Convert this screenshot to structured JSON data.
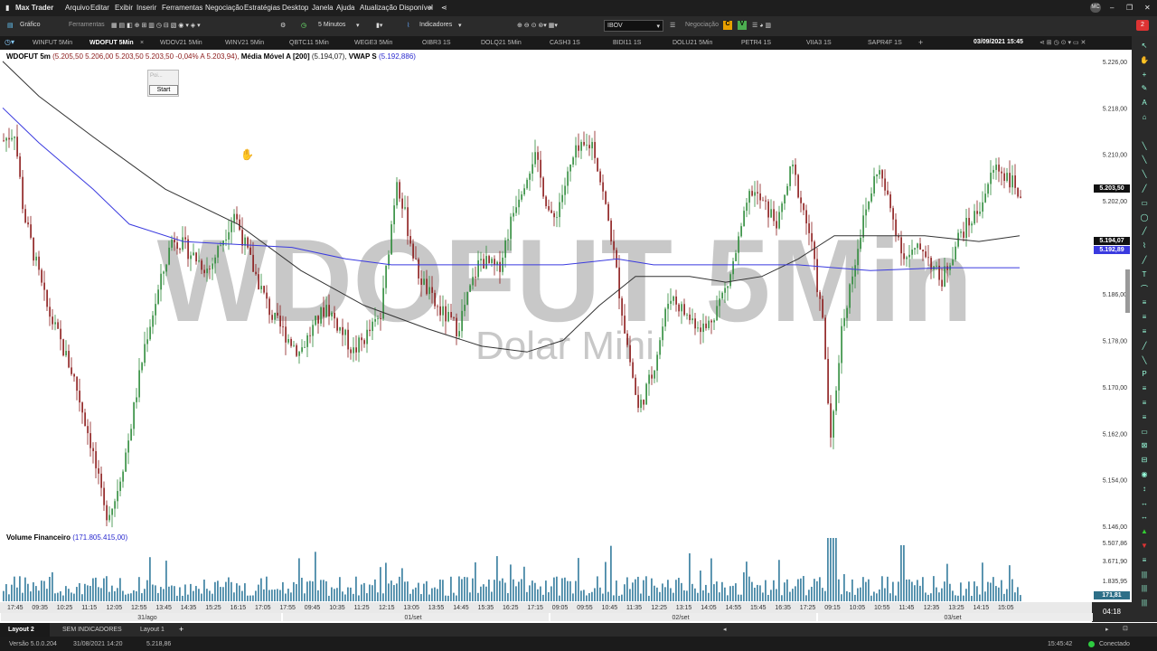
{
  "app": {
    "title": "Max Trader",
    "menu": [
      "Arquivo",
      "Editar",
      "Exibir",
      "Inserir",
      "Ferramentas",
      "Negociação",
      "Estratégias",
      "Desktop",
      "Janela",
      "Ajuda",
      "Atualização Disponível"
    ],
    "avatar": "MC",
    "notifications": "2"
  },
  "toolbar": {
    "grafico": "Gráfico",
    "ferramentas": "Ferramentas",
    "interval": "5 Minutos",
    "indicadores": "Indicadores",
    "symbol_input": "IBOV",
    "negociacao": "Negociação",
    "c_badge": "C",
    "v_badge": "V"
  },
  "tabs": [
    {
      "label": "WINFUT 5Min"
    },
    {
      "label": "WDOFUT 5Min",
      "active": true
    },
    {
      "label": "WDOV21 5Min"
    },
    {
      "label": "WINV21 5Min"
    },
    {
      "label": "QBTC11 5Min"
    },
    {
      "label": "WEGE3 5Min"
    },
    {
      "label": "OIBR3 1S"
    },
    {
      "label": "DOLQ21 5Min"
    },
    {
      "label": "CASH3 1S"
    },
    {
      "label": "BIDI11 1S"
    },
    {
      "label": "DOLU21 5Min"
    },
    {
      "label": "PETR4 1S"
    },
    {
      "label": "VIIA3 1S"
    },
    {
      "label": "SAPR4F 1S"
    }
  ],
  "tab_datetime": "03/09/2021 15:45",
  "chart": {
    "header_symbol": "WDOFUT 5m",
    "ohlc": "(5.205,50  5.206,00  5.203,50  5.203,50  -0,04%  A 5.203,94),",
    "ma_label": "Média Móvel A [200]",
    "ma_value": "(5.194,07),",
    "vwap_label": "VWAP S",
    "vwap_value": "(5.192,886)",
    "watermark": "WDOFUT 5Min",
    "watermark_sub": "Dolar Mini",
    "widget_placeholder": "Poi...",
    "start_button": "Start",
    "volume_label": "Volume Financeiro",
    "volume_value": "(171.805.415,00)",
    "price_ticks": [
      "5.226,00",
      "5.218,00",
      "5.210,00",
      "5.202,00",
      "5.186,00",
      "5.178,00",
      "5.170,00",
      "5.162,00",
      "5.154,00",
      "5.146,00"
    ],
    "volume_ticks": [
      "5.507,86",
      "3.671,90",
      "1.835,95"
    ],
    "last_price": "5.203,50",
    "ma_price": "5.194,07",
    "vwap_price": "5.192,89",
    "volume_tag": "171,81",
    "time_labels": [
      "17:45",
      "09:35",
      "10:25",
      "11:15",
      "12:05",
      "12:55",
      "13:45",
      "14:35",
      "15:25",
      "16:15",
      "17:05",
      "17:55",
      "09:45",
      "10:35",
      "11:25",
      "12:15",
      "13:05",
      "13:55",
      "14:45",
      "15:35",
      "16:25",
      "17:15",
      "09:05",
      "09:55",
      "10:45",
      "11:35",
      "12:25",
      "13:15",
      "14:05",
      "14:55",
      "15:45",
      "16:35",
      "17:25",
      "09:15",
      "10:05",
      "10:55",
      "11:45",
      "12:35",
      "13:25",
      "14:15",
      "15:05"
    ],
    "date_labels": [
      "31/ago",
      "01/set",
      "02/set",
      "03/set"
    ],
    "countdown": "04:18"
  },
  "chart_data": {
    "type": "candlestick",
    "symbol": "WDOFUT 5m",
    "y_range": [
      5144,
      5228
    ],
    "last": 5203.5,
    "ma200_last": 5194.07,
    "vwap_last": 5192.886,
    "key_levels": [
      5226,
      5218,
      5210,
      5202,
      5194,
      5186,
      5178,
      5170,
      5162,
      5154,
      5146
    ]
  },
  "bottom": {
    "layout_tab": "Layout 2",
    "sem_indicadores": "SEM INDICADORES",
    "layout1": "Layout 1",
    "plus": "+"
  },
  "status": {
    "version": "Versão 5.0.0.204",
    "date": "31/08/2021 14:20",
    "price": "5.218,86",
    "time": "15:45:42",
    "connection": "Conectado"
  },
  "colors": {
    "bull": "#2e8b3a",
    "bear": "#8b1a1a",
    "ma": "#333333",
    "vwap": "#3a3adf",
    "volume": "#4a8aa8"
  }
}
